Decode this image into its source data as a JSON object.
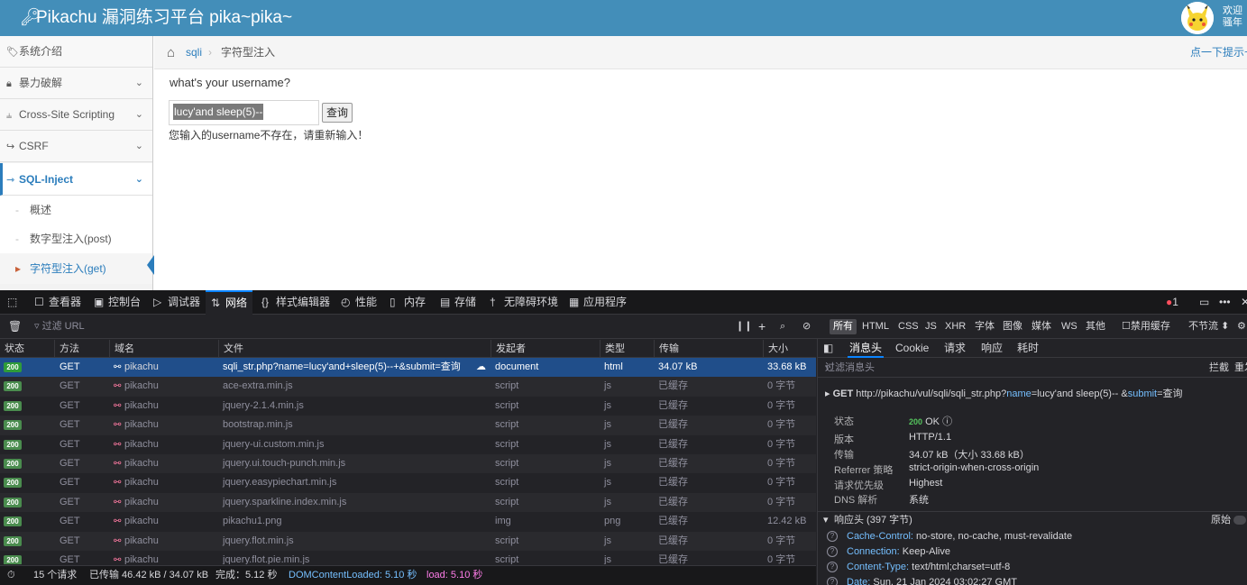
{
  "header": {
    "title": "Pikachu 漏洞练习平台 pika~pika~",
    "welcome_line1": "欢迎",
    "welcome_line2": "骚年"
  },
  "sidebar": {
    "items": [
      {
        "label": "系统介绍",
        "icon": "tag-icon"
      },
      {
        "label": "暴力破解",
        "icon": "lock-icon"
      },
      {
        "label": "Cross-Site Scripting",
        "icon": "xss-icon"
      },
      {
        "label": "CSRF",
        "icon": "share-icon"
      },
      {
        "label": "SQL-Inject",
        "icon": "inject-icon"
      }
    ],
    "subitems": [
      {
        "label": "概述"
      },
      {
        "label": "数字型注入(post)"
      },
      {
        "label": "字符型注入(get)"
      }
    ]
  },
  "breadcrumb": {
    "item1": "sqli",
    "item2": "字符型注入",
    "hint": "点一下提示~"
  },
  "main": {
    "question": "what's your username?",
    "input_value": "lucy'and sleep(5)--",
    "submit_label": "查询",
    "message": "您输入的username不存在，请重新输入！"
  },
  "devtools": {
    "tabs": [
      "查看器",
      "控制台",
      "调试器",
      "网络",
      "样式编辑器",
      "性能",
      "内存",
      "存储",
      "无障碍环境",
      "应用程序"
    ],
    "error_count": "1",
    "filter_placeholder": "过滤 URL",
    "filter_types": [
      "所有",
      "HTML",
      "CSS",
      "JS",
      "XHR",
      "字体",
      "图像",
      "媒体",
      "WS",
      "其他"
    ],
    "disable_cache": "禁用缓存",
    "throttle": "不节流",
    "columns": [
      "状态",
      "方法",
      "域名",
      "文件",
      "发起者",
      "类型",
      "传输",
      "大小"
    ],
    "requests": [
      {
        "status": "200",
        "method": "GET",
        "domain": "pikachu",
        "file": "sqli_str.php?name=lucy'and+sleep(5)--+&submit=查询",
        "initiator": "document",
        "type": "html",
        "transferred": "34.07 kB",
        "size": "33.68 kB"
      },
      {
        "status": "200",
        "method": "GET",
        "domain": "pikachu",
        "file": "ace-extra.min.js",
        "initiator": "script",
        "type": "js",
        "transferred": "已缓存",
        "size": "0 字节"
      },
      {
        "status": "200",
        "method": "GET",
        "domain": "pikachu",
        "file": "jquery-2.1.4.min.js",
        "initiator": "script",
        "type": "js",
        "transferred": "已缓存",
        "size": "0 字节"
      },
      {
        "status": "200",
        "method": "GET",
        "domain": "pikachu",
        "file": "bootstrap.min.js",
        "initiator": "script",
        "type": "js",
        "transferred": "已缓存",
        "size": "0 字节"
      },
      {
        "status": "200",
        "method": "GET",
        "domain": "pikachu",
        "file": "jquery-ui.custom.min.js",
        "initiator": "script",
        "type": "js",
        "transferred": "已缓存",
        "size": "0 字节"
      },
      {
        "status": "200",
        "method": "GET",
        "domain": "pikachu",
        "file": "jquery.ui.touch-punch.min.js",
        "initiator": "script",
        "type": "js",
        "transferred": "已缓存",
        "size": "0 字节"
      },
      {
        "status": "200",
        "method": "GET",
        "domain": "pikachu",
        "file": "jquery.easypiechart.min.js",
        "initiator": "script",
        "type": "js",
        "transferred": "已缓存",
        "size": "0 字节"
      },
      {
        "status": "200",
        "method": "GET",
        "domain": "pikachu",
        "file": "jquery.sparkline.index.min.js",
        "initiator": "script",
        "type": "js",
        "transferred": "已缓存",
        "size": "0 字节"
      },
      {
        "status": "200",
        "method": "GET",
        "domain": "pikachu",
        "file": "pikachu1.png",
        "initiator": "img",
        "type": "png",
        "transferred": "已缓存",
        "size": "12.42 kB"
      },
      {
        "status": "200",
        "method": "GET",
        "domain": "pikachu",
        "file": "jquery.flot.min.js",
        "initiator": "script",
        "type": "js",
        "transferred": "已缓存",
        "size": "0 字节"
      },
      {
        "status": "200",
        "method": "GET",
        "domain": "pikachu",
        "file": "jquery.flot.pie.min.js",
        "initiator": "script",
        "type": "js",
        "transferred": "已缓存",
        "size": "0 字节"
      }
    ],
    "summary": {
      "requests": "15 个请求",
      "transferred": "已传输 46.42 kB / 34.07 kB",
      "finish": "完成：5.12 秒",
      "domcontent": "DOMContentLoaded: 5.10 秒",
      "load": "load: 5.10 秒"
    },
    "panel": {
      "tabs": [
        "消息头",
        "Cookie",
        "请求",
        "响应",
        "耗时"
      ],
      "filter_placeholder": "过滤消息头",
      "block": "拦截",
      "resend": "重发",
      "request_method": "GET",
      "request_url_pre": "http://pikachu/vul/sqli/sqli_str.php?",
      "q1_key": "name",
      "q1_val": "=lucy'and sleep(5)-- &",
      "q2_key": "submit",
      "q2_val": "=查询",
      "fields": [
        {
          "k": "状态",
          "v": "OK"
        },
        {
          "k": "版本",
          "v": "HTTP/1.1"
        },
        {
          "k": "传输",
          "v": "34.07 kB（大小 33.68 kB）"
        },
        {
          "k": "Referrer 策略",
          "v": "strict-origin-when-cross-origin"
        },
        {
          "k": "请求优先级",
          "v": "Highest"
        },
        {
          "k": "DNS 解析",
          "v": "系统"
        }
      ],
      "status_code": "200",
      "response_headers_title": "响应头 (397 字节)",
      "raw_label": "原始",
      "headers": [
        {
          "k": "Cache-Control:",
          "v": "no-store, no-cache, must-revalidate"
        },
        {
          "k": "Connection:",
          "v": "Keep-Alive"
        },
        {
          "k": "Content-Type:",
          "v": "text/html;charset=utf-8"
        },
        {
          "k": "Date:",
          "v": "Sun, 21 Jan 2024 03:02:27 GMT"
        }
      ]
    }
  }
}
